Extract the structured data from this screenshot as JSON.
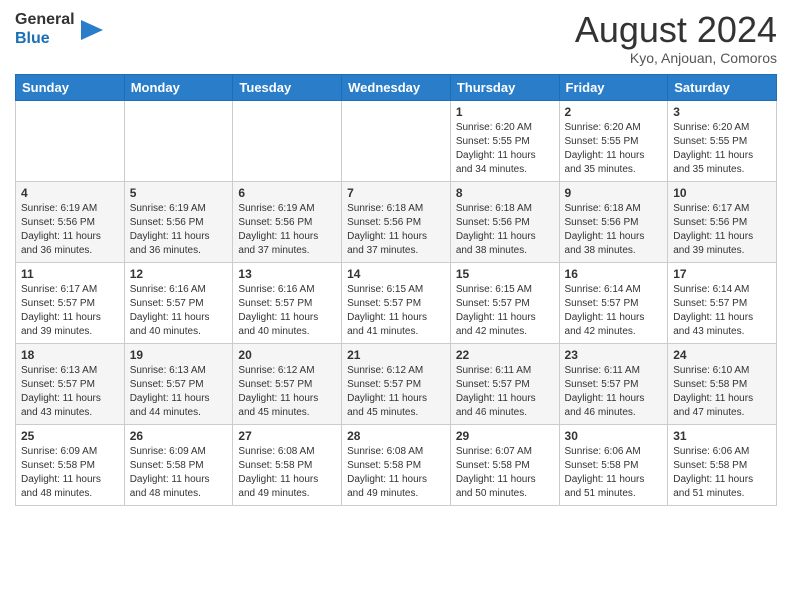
{
  "header": {
    "logo_general": "General",
    "logo_blue": "Blue",
    "month_title": "August 2024",
    "location": "Kyo, Anjouan, Comoros"
  },
  "weekdays": [
    "Sunday",
    "Monday",
    "Tuesday",
    "Wednesday",
    "Thursday",
    "Friday",
    "Saturday"
  ],
  "weeks": [
    [
      {
        "day": "",
        "sunrise": "",
        "sunset": "",
        "daylight": ""
      },
      {
        "day": "",
        "sunrise": "",
        "sunset": "",
        "daylight": ""
      },
      {
        "day": "",
        "sunrise": "",
        "sunset": "",
        "daylight": ""
      },
      {
        "day": "",
        "sunrise": "",
        "sunset": "",
        "daylight": ""
      },
      {
        "day": "1",
        "sunrise": "Sunrise: 6:20 AM",
        "sunset": "Sunset: 5:55 PM",
        "daylight": "Daylight: 11 hours and 34 minutes."
      },
      {
        "day": "2",
        "sunrise": "Sunrise: 6:20 AM",
        "sunset": "Sunset: 5:55 PM",
        "daylight": "Daylight: 11 hours and 35 minutes."
      },
      {
        "day": "3",
        "sunrise": "Sunrise: 6:20 AM",
        "sunset": "Sunset: 5:55 PM",
        "daylight": "Daylight: 11 hours and 35 minutes."
      }
    ],
    [
      {
        "day": "4",
        "sunrise": "Sunrise: 6:19 AM",
        "sunset": "Sunset: 5:56 PM",
        "daylight": "Daylight: 11 hours and 36 minutes."
      },
      {
        "day": "5",
        "sunrise": "Sunrise: 6:19 AM",
        "sunset": "Sunset: 5:56 PM",
        "daylight": "Daylight: 11 hours and 36 minutes."
      },
      {
        "day": "6",
        "sunrise": "Sunrise: 6:19 AM",
        "sunset": "Sunset: 5:56 PM",
        "daylight": "Daylight: 11 hours and 37 minutes."
      },
      {
        "day": "7",
        "sunrise": "Sunrise: 6:18 AM",
        "sunset": "Sunset: 5:56 PM",
        "daylight": "Daylight: 11 hours and 37 minutes."
      },
      {
        "day": "8",
        "sunrise": "Sunrise: 6:18 AM",
        "sunset": "Sunset: 5:56 PM",
        "daylight": "Daylight: 11 hours and 38 minutes."
      },
      {
        "day": "9",
        "sunrise": "Sunrise: 6:18 AM",
        "sunset": "Sunset: 5:56 PM",
        "daylight": "Daylight: 11 hours and 38 minutes."
      },
      {
        "day": "10",
        "sunrise": "Sunrise: 6:17 AM",
        "sunset": "Sunset: 5:56 PM",
        "daylight": "Daylight: 11 hours and 39 minutes."
      }
    ],
    [
      {
        "day": "11",
        "sunrise": "Sunrise: 6:17 AM",
        "sunset": "Sunset: 5:57 PM",
        "daylight": "Daylight: 11 hours and 39 minutes."
      },
      {
        "day": "12",
        "sunrise": "Sunrise: 6:16 AM",
        "sunset": "Sunset: 5:57 PM",
        "daylight": "Daylight: 11 hours and 40 minutes."
      },
      {
        "day": "13",
        "sunrise": "Sunrise: 6:16 AM",
        "sunset": "Sunset: 5:57 PM",
        "daylight": "Daylight: 11 hours and 40 minutes."
      },
      {
        "day": "14",
        "sunrise": "Sunrise: 6:15 AM",
        "sunset": "Sunset: 5:57 PM",
        "daylight": "Daylight: 11 hours and 41 minutes."
      },
      {
        "day": "15",
        "sunrise": "Sunrise: 6:15 AM",
        "sunset": "Sunset: 5:57 PM",
        "daylight": "Daylight: 11 hours and 42 minutes."
      },
      {
        "day": "16",
        "sunrise": "Sunrise: 6:14 AM",
        "sunset": "Sunset: 5:57 PM",
        "daylight": "Daylight: 11 hours and 42 minutes."
      },
      {
        "day": "17",
        "sunrise": "Sunrise: 6:14 AM",
        "sunset": "Sunset: 5:57 PM",
        "daylight": "Daylight: 11 hours and 43 minutes."
      }
    ],
    [
      {
        "day": "18",
        "sunrise": "Sunrise: 6:13 AM",
        "sunset": "Sunset: 5:57 PM",
        "daylight": "Daylight: 11 hours and 43 minutes."
      },
      {
        "day": "19",
        "sunrise": "Sunrise: 6:13 AM",
        "sunset": "Sunset: 5:57 PM",
        "daylight": "Daylight: 11 hours and 44 minutes."
      },
      {
        "day": "20",
        "sunrise": "Sunrise: 6:12 AM",
        "sunset": "Sunset: 5:57 PM",
        "daylight": "Daylight: 11 hours and 45 minutes."
      },
      {
        "day": "21",
        "sunrise": "Sunrise: 6:12 AM",
        "sunset": "Sunset: 5:57 PM",
        "daylight": "Daylight: 11 hours and 45 minutes."
      },
      {
        "day": "22",
        "sunrise": "Sunrise: 6:11 AM",
        "sunset": "Sunset: 5:57 PM",
        "daylight": "Daylight: 11 hours and 46 minutes."
      },
      {
        "day": "23",
        "sunrise": "Sunrise: 6:11 AM",
        "sunset": "Sunset: 5:57 PM",
        "daylight": "Daylight: 11 hours and 46 minutes."
      },
      {
        "day": "24",
        "sunrise": "Sunrise: 6:10 AM",
        "sunset": "Sunset: 5:58 PM",
        "daylight": "Daylight: 11 hours and 47 minutes."
      }
    ],
    [
      {
        "day": "25",
        "sunrise": "Sunrise: 6:09 AM",
        "sunset": "Sunset: 5:58 PM",
        "daylight": "Daylight: 11 hours and 48 minutes."
      },
      {
        "day": "26",
        "sunrise": "Sunrise: 6:09 AM",
        "sunset": "Sunset: 5:58 PM",
        "daylight": "Daylight: 11 hours and 48 minutes."
      },
      {
        "day": "27",
        "sunrise": "Sunrise: 6:08 AM",
        "sunset": "Sunset: 5:58 PM",
        "daylight": "Daylight: 11 hours and 49 minutes."
      },
      {
        "day": "28",
        "sunrise": "Sunrise: 6:08 AM",
        "sunset": "Sunset: 5:58 PM",
        "daylight": "Daylight: 11 hours and 49 minutes."
      },
      {
        "day": "29",
        "sunrise": "Sunrise: 6:07 AM",
        "sunset": "Sunset: 5:58 PM",
        "daylight": "Daylight: 11 hours and 50 minutes."
      },
      {
        "day": "30",
        "sunrise": "Sunrise: 6:06 AM",
        "sunset": "Sunset: 5:58 PM",
        "daylight": "Daylight: 11 hours and 51 minutes."
      },
      {
        "day": "31",
        "sunrise": "Sunrise: 6:06 AM",
        "sunset": "Sunset: 5:58 PM",
        "daylight": "Daylight: 11 hours and 51 minutes."
      }
    ]
  ]
}
